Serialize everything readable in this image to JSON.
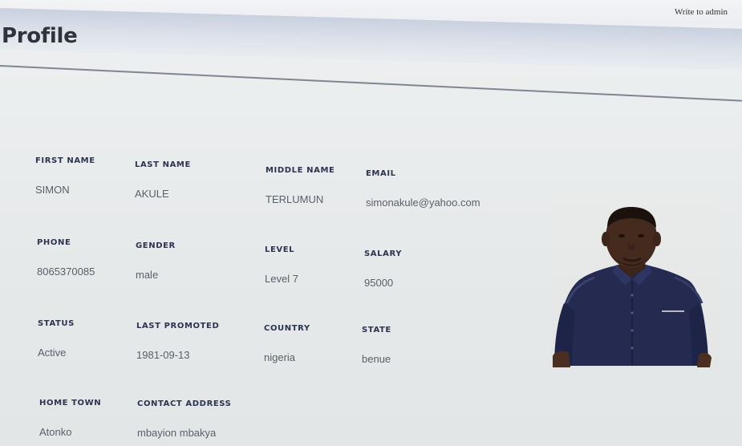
{
  "header": {
    "admin_link": "Write to admin",
    "title": "Profile"
  },
  "profile": {
    "first_name": {
      "label": "FIRST NAME",
      "value": "SIMON"
    },
    "last_name": {
      "label": "LAST NAME",
      "value": "AKULE"
    },
    "middle_name": {
      "label": "MIDDLE NAME",
      "value": "TERLUMUN"
    },
    "email": {
      "label": "EMAIL",
      "value": "simonakule@yahoo.com"
    },
    "phone": {
      "label": "PHONE",
      "value": "8065370085"
    },
    "gender": {
      "label": "GENDER",
      "value": "male"
    },
    "level": {
      "label": "LEVEL",
      "value": "Level 7"
    },
    "salary": {
      "label": "SALARY",
      "value": "95000"
    },
    "status": {
      "label": "STATUS",
      "value": "Active"
    },
    "last_promoted": {
      "label": "LAST PROMOTED",
      "value": "1981-09-13"
    },
    "country": {
      "label": "COUNTRY",
      "value": "nigeria"
    },
    "state": {
      "label": "STATE",
      "value": "benue"
    },
    "home_town": {
      "label": "HOME TOWN",
      "value": "Atonko"
    },
    "contact_address": {
      "label": "CONTACT ADDRESS",
      "value": "mbayion mbakya"
    }
  },
  "photo": {
    "icon": "profile-photo"
  },
  "colors": {
    "label": "#2d3350",
    "value": "#5b5f68",
    "header_band": "#c9d1e0",
    "shirt": "#232a52"
  }
}
